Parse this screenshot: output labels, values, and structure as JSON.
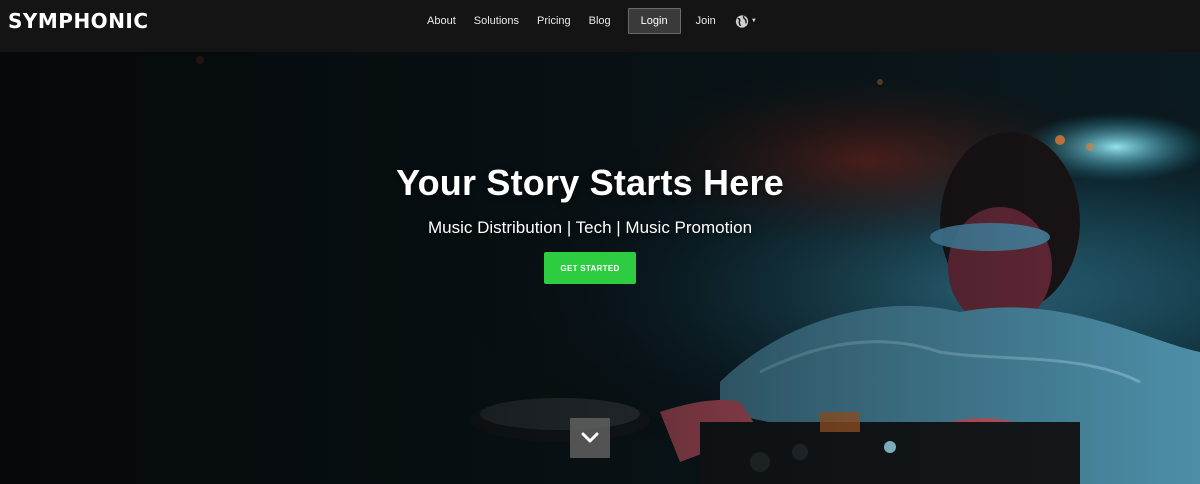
{
  "brand": {
    "logo_text": "SYMPHONIC"
  },
  "nav": {
    "items": [
      {
        "label": "About"
      },
      {
        "label": "Solutions"
      },
      {
        "label": "Pricing"
      },
      {
        "label": "Blog"
      }
    ],
    "login_label": "Login",
    "join_label": "Join",
    "language_icon": "globe-icon"
  },
  "hero": {
    "title": "Your Story Starts Here",
    "subtitle": "Music Distribution | Tech | Music Promotion",
    "cta_label": "GET STARTED",
    "scroll_icon": "chevron-down-icon",
    "accent_color": "#2ecc40",
    "background_image": "DJ performing at mixer under blue and red club lighting"
  }
}
